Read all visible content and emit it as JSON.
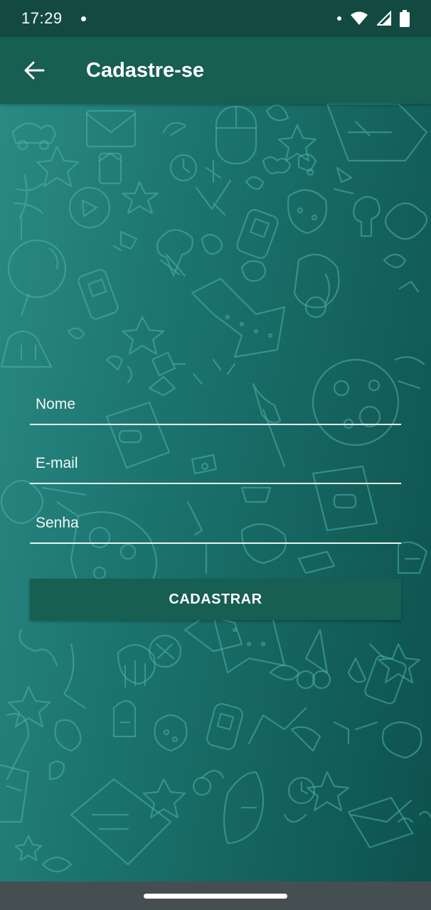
{
  "status_bar": {
    "time": "17:29",
    "icons": [
      "notification-dot-icon",
      "wifi-icon",
      "signal-icon",
      "battery-icon"
    ]
  },
  "app_bar": {
    "back_icon": "arrow-left-icon",
    "title": "Cadastre-se",
    "color": "#175e53"
  },
  "form": {
    "name_placeholder": "Nome",
    "email_placeholder": "E-mail",
    "password_placeholder": "Senha",
    "submit_label": "CADASTRAR"
  },
  "colors": {
    "status_bar": "#124a42",
    "app_bar": "#175e53",
    "button": "#175e53",
    "background_light": "#2a8a84",
    "background_dark": "#0e514d",
    "doodle": "#4fb3aa",
    "nav_bar": "#454f52"
  }
}
